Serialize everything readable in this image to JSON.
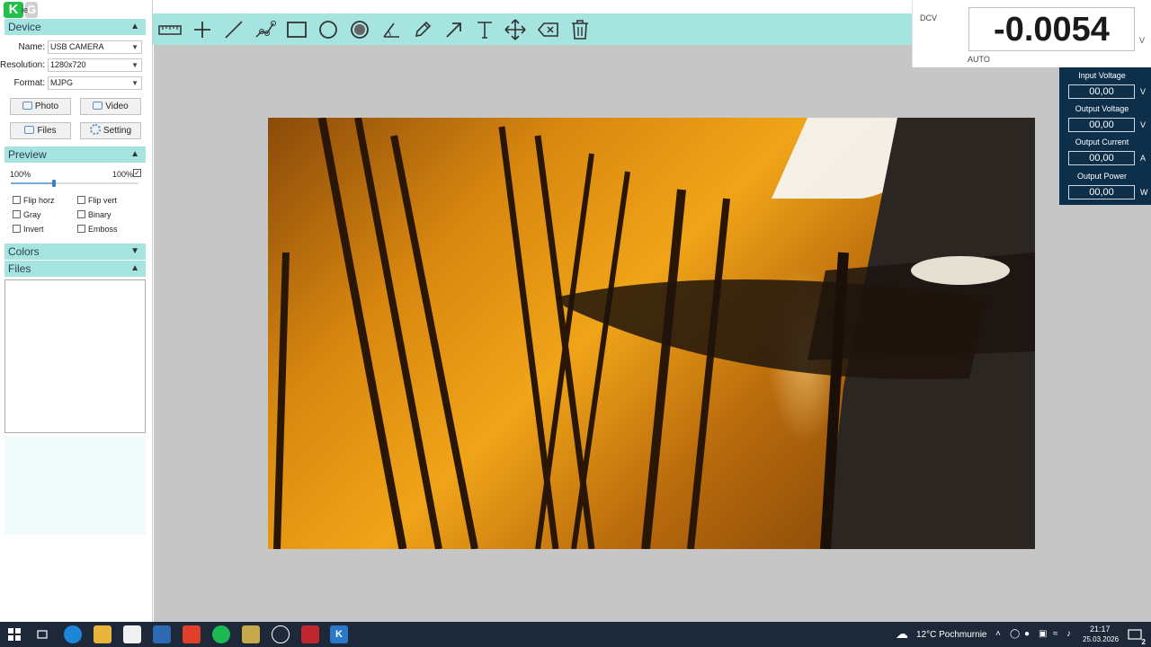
{
  "app": {
    "title_fragment": "ie"
  },
  "device": {
    "header": "Device",
    "name_label": "Name:",
    "name_value": "USB CAMERA",
    "resolution_label": "Resolution:",
    "resolution_value": "1280x720",
    "format_label": "Format:",
    "format_value": "MJPG",
    "photo_label": "Photo",
    "video_label": "Video",
    "files_label": "Files",
    "setting_label": "Setting"
  },
  "preview": {
    "header": "Preview",
    "min_label": "100%",
    "max_label": "100%",
    "zoom_level": 0.34,
    "max_checked": true,
    "checkboxes": {
      "flip_horz": "Flip horz",
      "flip_vert": "Flip vert",
      "gray": "Gray",
      "binary": "Binary",
      "invert": "Invert",
      "emboss": "Emboss"
    }
  },
  "colors": {
    "header": "Colors"
  },
  "files": {
    "header": "Files"
  },
  "toolbar": {
    "tools": [
      "ruler-icon",
      "crosshair-icon",
      "line-icon",
      "polyline-icon",
      "rectangle-icon",
      "circle-icon",
      "filled-circle-icon",
      "angle-icon",
      "pencil-icon",
      "arrow-icon",
      "text-icon",
      "move-icon",
      "erase-icon",
      "delete-icon"
    ]
  },
  "meter": {
    "mode": "DCV",
    "reading": "-0.0054",
    "unit": "V",
    "range": "AUTO"
  },
  "power": {
    "input_voltage_label": "Input Voltage",
    "input_voltage_value": "00,00",
    "input_voltage_unit": "V",
    "output_voltage_label": "Output Voltage",
    "output_voltage_value": "00,00",
    "output_voltage_unit": "V",
    "output_current_label": "Output Current",
    "output_current_value": "00,00",
    "output_current_unit": "A",
    "output_power_label": "Output Power",
    "output_power_value": "00,00",
    "output_power_unit": "W"
  },
  "taskbar": {
    "weather": "12°C  Pochmurnie",
    "time": "21:17",
    "date": "25.03.2026",
    "notification_count": "2"
  },
  "colors_theme": {
    "accent_teal": "#a6e4e0",
    "panel_navy": "#0d2f4a",
    "canvas_gray": "#c6c6c6"
  }
}
